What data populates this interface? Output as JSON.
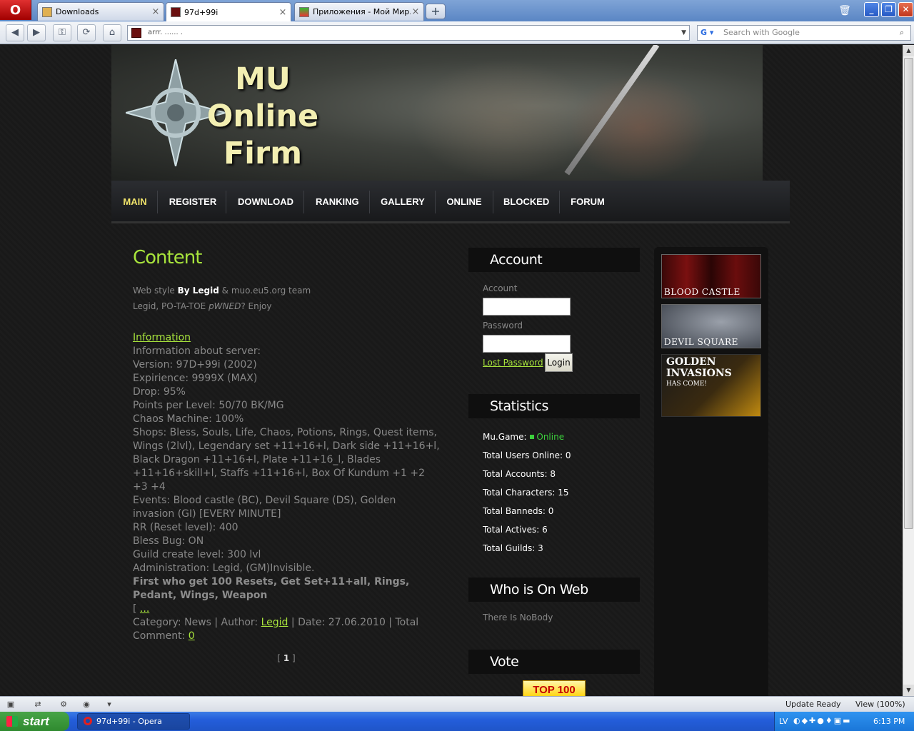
{
  "browser": {
    "tabs": [
      {
        "label": "Downloads"
      },
      {
        "label": "97d+99i"
      },
      {
        "label": "Приложения - Мой Мир..."
      }
    ],
    "new_tab_icon": "plus-icon",
    "address": "arrr.  ...... .",
    "search_placeholder": "Search with Google",
    "search_engine": "G",
    "status": "Update Ready",
    "zoom": "View (100%)"
  },
  "header": {
    "logo_line1": "MU",
    "logo_line2": "Online",
    "logo_line3": "Firm"
  },
  "menu": {
    "items": [
      "MAIN",
      "REGISTER",
      "DOWNLOAD",
      "RANKING",
      "GALLERY",
      "ONLINE",
      "BLOCKED",
      "FORUM"
    ]
  },
  "content": {
    "title": "Content",
    "style_prefix": "Web style",
    "style_author": "By Legid",
    "style_suffix": "& muo.eu5.org team",
    "tagline_1": "Legid, PO-TA-TOE",
    "tagline_2": "pWNED",
    "tagline_3": "? Enjoy",
    "news_title": "Information",
    "lines": [
      "Information about server:",
      "Version: 97D+99i (2002)",
      "Expirience: 9999X (MAX)",
      "Drop: 95%",
      "Points per Level: 50/70 BK/MG",
      "Chaos Machine: 100%",
      "Shops: Bless, Souls, Life, Chaos, Potions, Rings, Quest items, Wings (2lvl), Legendary set +11+16+l, Dark side +11+16+l, Black Dragon +11+16+l, Plate +11+16_l, Blades +11+16+skill+l, Staffs +11+16+l, Box Of Kundum +1 +2 +3 +4",
      "Events: Blood castle (BC), Devil Square (DS), Golden invasion (GI) [EVERY MINUTE]",
      "RR (Reset level): 400",
      "Bless Bug: ON",
      "Guild create level: 300 lvl",
      "Administration: Legid, (GM)Invisible."
    ],
    "bold_line": "First who get 100 Resets, Get Set+11+all, Rings, Pedant, Wings, Weapon",
    "more_prefix": "[",
    "more_link": "...",
    "meta_1": "Category: News | Author:",
    "meta_author": "Legid",
    "meta_2": "| Date: 27.06.2010 | Total Comment:",
    "meta_comments": "0",
    "pager_left": "[",
    "pager_page": "1",
    "pager_right": "]"
  },
  "account": {
    "heading": "Account",
    "account_label": "Account",
    "password_label": "Password",
    "lost_password": "Lost Password",
    "login": "Login"
  },
  "statistics": {
    "heading": "Statistics",
    "game_label": "Mu.Game:",
    "game_status": "Online",
    "rows": [
      "Total Users Online: 0",
      "Total Accounts: 8",
      "Total Characters: 15",
      "Total Banneds: 0",
      "Total Actives: 6",
      "Total Guilds: 3"
    ]
  },
  "who_on_web": {
    "heading": "Who is On Web",
    "text": "There Is NoBody"
  },
  "vote": {
    "heading": "Vote",
    "badge": "TOP 100"
  },
  "events": {
    "banner1": "BLOOD CASTLE",
    "banner2": "DEVIL SQUARE",
    "banner3_title": "GOLDEN INVASIONS",
    "banner3_sub": "HAS COME!"
  },
  "taskbar": {
    "start": "start",
    "task": "97d+99i - Opera",
    "lang": "LV",
    "clock": "6:13 PM"
  },
  "colors": {
    "accent_green": "#a8e43c",
    "menu_active": "#f0e36a",
    "online_green": "#3ccf3c"
  }
}
